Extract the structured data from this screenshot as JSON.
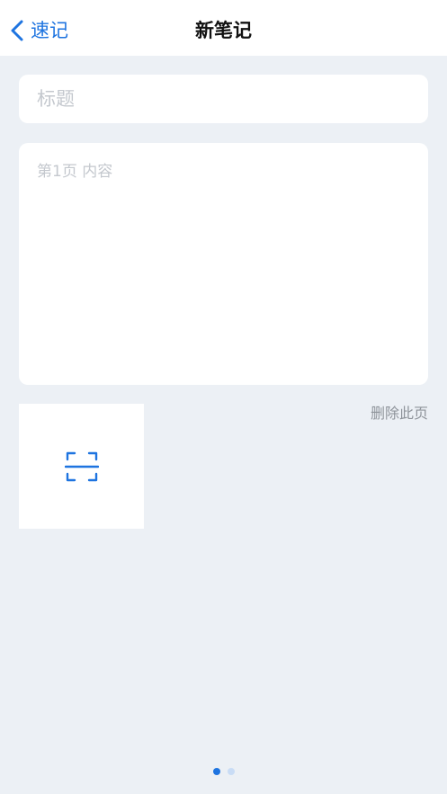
{
  "navbar": {
    "back_label": "速记",
    "title": "新笔记",
    "back_icon": "chevron-left-icon"
  },
  "editor": {
    "title_placeholder": "标题",
    "title_value": "",
    "content_placeholder": "第1页 内容",
    "content_value": ""
  },
  "page_actions": {
    "scan_icon": "scan-icon",
    "delete_label": "删除此页"
  },
  "pager": {
    "total": 2,
    "current": 1
  },
  "colors": {
    "accent": "#1E74E0",
    "background": "#ECF0F5",
    "card": "#FFFFFF",
    "placeholder": "#C4C8CE",
    "secondary_text": "#8E939A",
    "inactive_dot": "#C9DCF5"
  }
}
